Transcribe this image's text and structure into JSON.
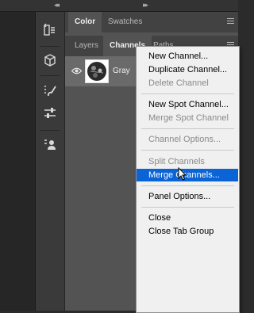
{
  "panel": {
    "tabs_top": [
      {
        "label": "Color",
        "active": true
      },
      {
        "label": "Swatches",
        "active": false
      }
    ],
    "tabs_bottom": [
      {
        "label": "Layers",
        "active": false
      },
      {
        "label": "Channels",
        "active": true
      },
      {
        "label": "Paths",
        "active": false
      }
    ],
    "channel": {
      "name": "Gray",
      "visible": true
    }
  },
  "tools": [
    "history-icon",
    "3d-cube-icon",
    "brush-settings-icon",
    "adjustments-icon",
    "properties-icon"
  ],
  "menu": {
    "items": [
      {
        "label": "New Channel...",
        "enabled": true
      },
      {
        "label": "Duplicate Channel...",
        "enabled": true
      },
      {
        "label": "Delete Channel",
        "enabled": false
      },
      {
        "label": "New Spot Channel...",
        "enabled": true
      },
      {
        "label": "Merge Spot Channel",
        "enabled": false
      },
      {
        "label": "Channel Options...",
        "enabled": false
      },
      {
        "label": "Split Channels",
        "enabled": false
      },
      {
        "label": "Merge Channels...",
        "enabled": true,
        "highlighted": true
      },
      {
        "label": "Panel Options...",
        "enabled": true
      },
      {
        "label": "Close",
        "enabled": true
      },
      {
        "label": "Close Tab Group",
        "enabled": true
      }
    ]
  },
  "colors": {
    "highlight": "#0a64d6",
    "menu_bg": "#f0f0f0",
    "panel_bg": "#535353"
  }
}
